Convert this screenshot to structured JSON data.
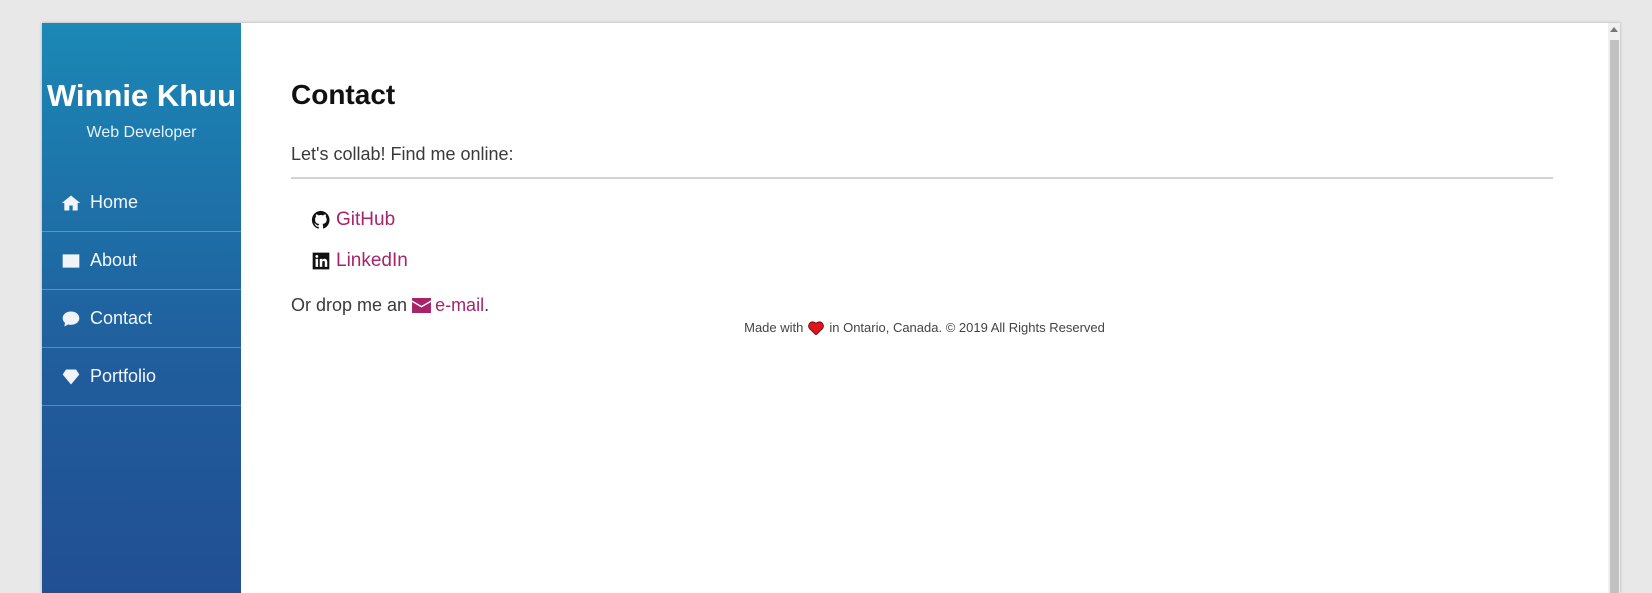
{
  "sidebar": {
    "name": "Winnie Khuu",
    "role": "Web Developer",
    "items": [
      {
        "label": "Home",
        "icon": "home-icon"
      },
      {
        "label": "About",
        "icon": "id-card-icon"
      },
      {
        "label": "Contact",
        "icon": "chat-icon"
      },
      {
        "label": "Portfolio",
        "icon": "diamond-icon"
      }
    ]
  },
  "main": {
    "title": "Contact",
    "intro": "Let's collab! Find me online:",
    "links": [
      {
        "label": "GitHub",
        "icon": "github-icon"
      },
      {
        "label": "LinkedIn",
        "icon": "linkedin-icon"
      }
    ],
    "email_prefix": "Or drop me an",
    "email_label": "e-mail",
    "email_suffix": "."
  },
  "footer": {
    "before": "Made with",
    "after": "in Ontario, Canada. © 2019 All Rights Reserved"
  },
  "colors": {
    "link": "#a7246b",
    "sidebar_top": "#1b88b6",
    "sidebar_bottom": "#214f94",
    "heart": "#e0141e"
  }
}
